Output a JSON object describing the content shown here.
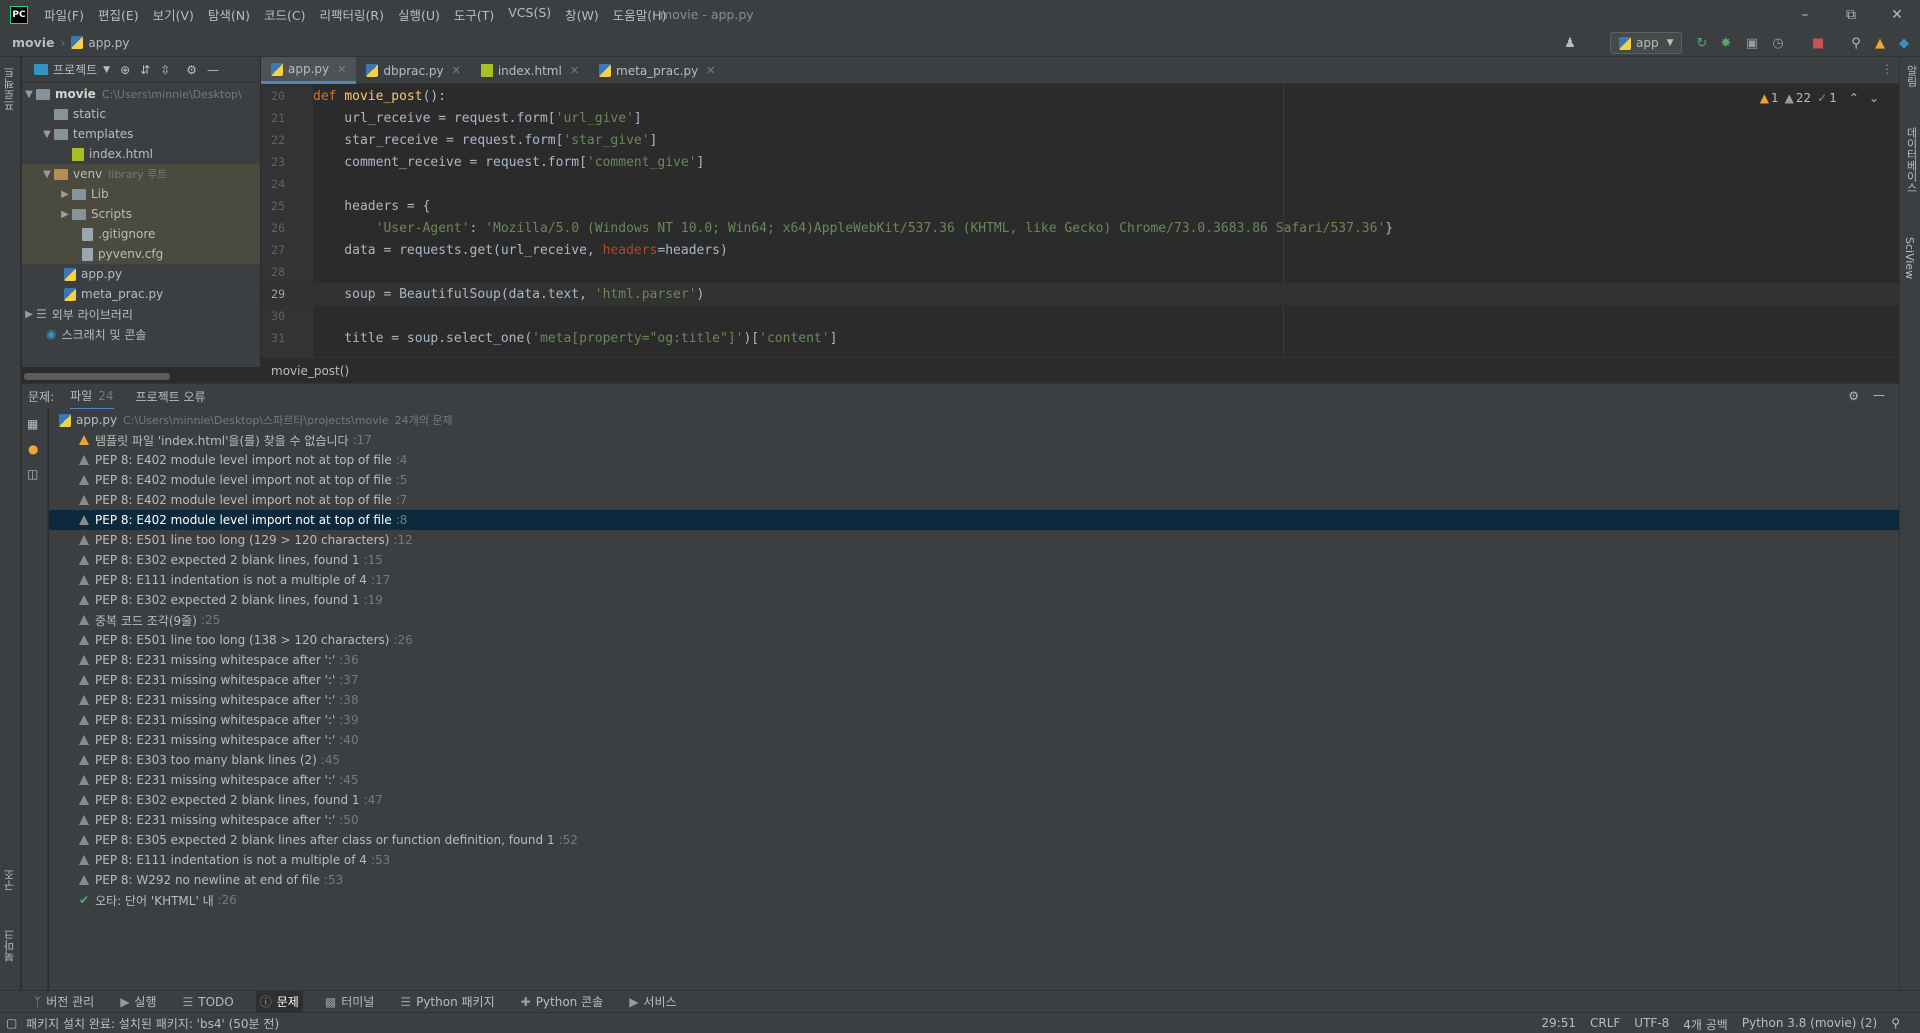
{
  "titlebar": {
    "logo": "PC",
    "menu": [
      "파일(F)",
      "편집(E)",
      "보기(V)",
      "탐색(N)",
      "코드(C)",
      "리팩터링(R)",
      "실행(U)",
      "도구(T)",
      "VCS(S)",
      "창(W)",
      "도움말(H)"
    ],
    "title": "movie - app.py"
  },
  "navbar": {
    "project": "movie",
    "file": "app.py",
    "run_config": "app"
  },
  "sidebar": {
    "project_label": "프로젝트",
    "structure_label": "구조",
    "bookmarks_label": "북마크"
  },
  "rightbar": {
    "notifications": "알림",
    "database": "데이터베이스",
    "sciview": "SciView"
  },
  "project": {
    "header": "프로젝트",
    "root": {
      "name": "movie",
      "path": "C:\\Users\\minnie\\Desktop\\"
    },
    "items": [
      {
        "label": "static"
      },
      {
        "label": "templates"
      },
      {
        "label": "index.html"
      },
      {
        "label": "venv",
        "note": "library 루트"
      },
      {
        "label": "Lib"
      },
      {
        "label": "Scripts"
      },
      {
        "label": ".gitignore"
      },
      {
        "label": "pyvenv.cfg"
      },
      {
        "label": "app.py"
      },
      {
        "label": "meta_prac.py"
      },
      {
        "label": "외부 라이브러리"
      },
      {
        "label": "스크래치 및 콘솔"
      }
    ]
  },
  "editor": {
    "tabs": [
      "app.py",
      "dbprac.py",
      "index.html",
      "meta_prac.py"
    ],
    "inspections": {
      "warnings": "1",
      "weak": "22",
      "ok": "1"
    },
    "lines": [
      {
        "n": "20",
        "text": "def movie_post():"
      },
      {
        "n": "21",
        "text": "    url_receive = request.form['url_give']"
      },
      {
        "n": "22",
        "text": "    star_receive = request.form['star_give']"
      },
      {
        "n": "23",
        "text": "    comment_receive = request.form['comment_give']"
      },
      {
        "n": "24",
        "text": ""
      },
      {
        "n": "25",
        "text": "    headers = {"
      },
      {
        "n": "26",
        "text": "        'User-Agent': 'Mozilla/5.0 (Windows NT 10.0; Win64; x64)AppleWebKit/537.36 (KHTML, like Gecko) Chrome/73.0.3683.86 Safari/537.36'}"
      },
      {
        "n": "27",
        "text": "    data = requests.get(url_receive, headers=headers)"
      },
      {
        "n": "28",
        "text": ""
      },
      {
        "n": "29",
        "text": "    soup = BeautifulSoup(data.text, 'html.parser')"
      },
      {
        "n": "30",
        "text": ""
      },
      {
        "n": "31",
        "text": "    title = soup.select_one('meta[property=\"og:title\"]')['content']"
      }
    ],
    "breadcrumb": "movie_post()"
  },
  "problems": {
    "label": "문제:",
    "tabs": [
      {
        "label": "파일",
        "count": "24"
      },
      {
        "label": "프로젝트 오류",
        "count": ""
      }
    ],
    "file": {
      "name": "app.py",
      "path": "C:\\Users\\minnie\\Desktop\\스파르타\\projects\\movie",
      "summary": "24개의 문제"
    },
    "items": [
      {
        "text": "템플릿 파일 'index.html'을(를) 찾을 수 없습니다",
        "line": ":17",
        "kind": "warn"
      },
      {
        "text": "PEP 8: E402 module level import not at top of file",
        "line": ":4",
        "kind": "weak"
      },
      {
        "text": "PEP 8: E402 module level import not at top of file",
        "line": ":5",
        "kind": "weak"
      },
      {
        "text": "PEP 8: E402 module level import not at top of file",
        "line": ":7",
        "kind": "weak"
      },
      {
        "text": "PEP 8: E402 module level import not at top of file",
        "line": ":8",
        "kind": "weak"
      },
      {
        "text": "PEP 8: E501 line too long (129 > 120 characters)",
        "line": ":12",
        "kind": "weak"
      },
      {
        "text": "PEP 8: E302 expected 2 blank lines, found 1",
        "line": ":15",
        "kind": "weak"
      },
      {
        "text": "PEP 8: E111 indentation is not a multiple of 4",
        "line": ":17",
        "kind": "weak"
      },
      {
        "text": "PEP 8: E302 expected 2 blank lines, found 1",
        "line": ":19",
        "kind": "weak"
      },
      {
        "text": "중복 코드 조각(9줄)",
        "line": ":25",
        "kind": "weak"
      },
      {
        "text": "PEP 8: E501 line too long (138 > 120 characters)",
        "line": ":26",
        "kind": "weak"
      },
      {
        "text": "PEP 8: E231 missing whitespace after ':'",
        "line": ":36",
        "kind": "weak"
      },
      {
        "text": "PEP 8: E231 missing whitespace after ':'",
        "line": ":37",
        "kind": "weak"
      },
      {
        "text": "PEP 8: E231 missing whitespace after ':'",
        "line": ":38",
        "kind": "weak"
      },
      {
        "text": "PEP 8: E231 missing whitespace after ':'",
        "line": ":39",
        "kind": "weak"
      },
      {
        "text": "PEP 8: E231 missing whitespace after ':'",
        "line": ":40",
        "kind": "weak"
      },
      {
        "text": "PEP 8: E303 too many blank lines (2)",
        "line": ":45",
        "kind": "weak"
      },
      {
        "text": "PEP 8: E231 missing whitespace after ':'",
        "line": ":45",
        "kind": "weak"
      },
      {
        "text": "PEP 8: E302 expected 2 blank lines, found 1",
        "line": ":47",
        "kind": "weak"
      },
      {
        "text": "PEP 8: E231 missing whitespace after ':'",
        "line": ":50",
        "kind": "weak"
      },
      {
        "text": "PEP 8: E305 expected 2 blank lines after class or function definition, found 1",
        "line": ":52",
        "kind": "weak"
      },
      {
        "text": "PEP 8: E111 indentation is not a multiple of 4",
        "line": ":53",
        "kind": "weak"
      },
      {
        "text": "PEP 8: W292 no newline at end of file",
        "line": ":53",
        "kind": "weak"
      },
      {
        "text": "오타: 단어 'KHTML' 내",
        "line": ":26",
        "kind": "typo"
      }
    ]
  },
  "toolwindows": [
    "버전 관리",
    "실행",
    "TODO",
    "문제",
    "터미널",
    "Python 패키지",
    "Python 콘솔",
    "서비스"
  ],
  "status": {
    "message": "패키지 설치 완료: 설치된 패키지: 'bs4' (50분 전)",
    "position": "29:51",
    "line_sep": "CRLF",
    "encoding": "UTF-8",
    "indent": "4개 공백",
    "interpreter": "Python 3.8 (movie) (2)"
  },
  "colors": {
    "accent": "#4a88c7",
    "selection": "#0d293e",
    "warning": "#e8a33e"
  }
}
